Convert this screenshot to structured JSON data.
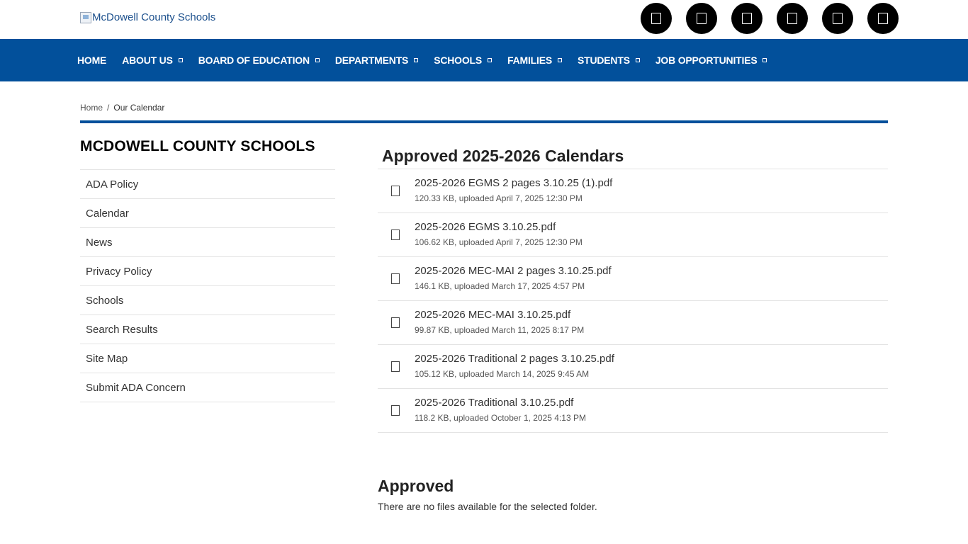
{
  "header": {
    "logo_alt": "McDowell County Schools",
    "social_icons": [
      "social-icon-1",
      "social-icon-2",
      "social-icon-3",
      "social-icon-4",
      "social-icon-5",
      "social-icon-6"
    ]
  },
  "nav": {
    "items": [
      {
        "label": "HOME",
        "has_dropdown": false
      },
      {
        "label": "ABOUT US",
        "has_dropdown": true
      },
      {
        "label": "BOARD OF EDUCATION",
        "has_dropdown": true
      },
      {
        "label": "DEPARTMENTS",
        "has_dropdown": true
      },
      {
        "label": "SCHOOLS",
        "has_dropdown": true
      },
      {
        "label": "FAMILIES",
        "has_dropdown": true
      },
      {
        "label": "STUDENTS",
        "has_dropdown": true
      },
      {
        "label": "JOB OPPORTUNITIES",
        "has_dropdown": true
      }
    ]
  },
  "breadcrumb": {
    "home": "Home",
    "separator": "/",
    "current": "Our Calendar"
  },
  "sidebar": {
    "title": "MCDOWELL COUNTY SCHOOLS",
    "items": [
      {
        "label": "ADA Policy"
      },
      {
        "label": "Calendar"
      },
      {
        "label": "News"
      },
      {
        "label": "Privacy Policy"
      },
      {
        "label": "Schools"
      },
      {
        "label": "Search Results"
      },
      {
        "label": "Site Map"
      },
      {
        "label": "Submit ADA Concern"
      }
    ]
  },
  "main": {
    "section_title": "Approved 2025-2026 Calendars",
    "files": [
      {
        "name": "2025-2026 EGMS 2 pages 3.10.25 (1).pdf",
        "meta": "120.33 KB, uploaded April 7, 2025 12:30 PM"
      },
      {
        "name": "2025-2026 EGMS 3.10.25.pdf",
        "meta": "106.62 KB, uploaded April 7, 2025 12:30 PM"
      },
      {
        "name": "2025-2026 MEC-MAI 2 pages 3.10.25.pdf",
        "meta": "146.1 KB, uploaded March 17, 2025 4:57 PM"
      },
      {
        "name": "2025-2026 MEC-MAI 3.10.25.pdf",
        "meta": "99.87 KB, uploaded March 11, 2025 8:17 PM"
      },
      {
        "name": "2025-2026 Traditional 2 pages 3.10.25.pdf",
        "meta": "105.12 KB, uploaded March 14, 2025 9:45 AM"
      },
      {
        "name": "2025-2026 Traditional 3.10.25.pdf",
        "meta": "118.2 KB, uploaded October 1, 2025 4:13 PM"
      }
    ],
    "approved_title": "Approved",
    "approved_empty": "There are no files available for the selected folder."
  },
  "colors": {
    "nav_bg": "#02509b",
    "divider": "#02509b",
    "social_bg": "#000000"
  }
}
